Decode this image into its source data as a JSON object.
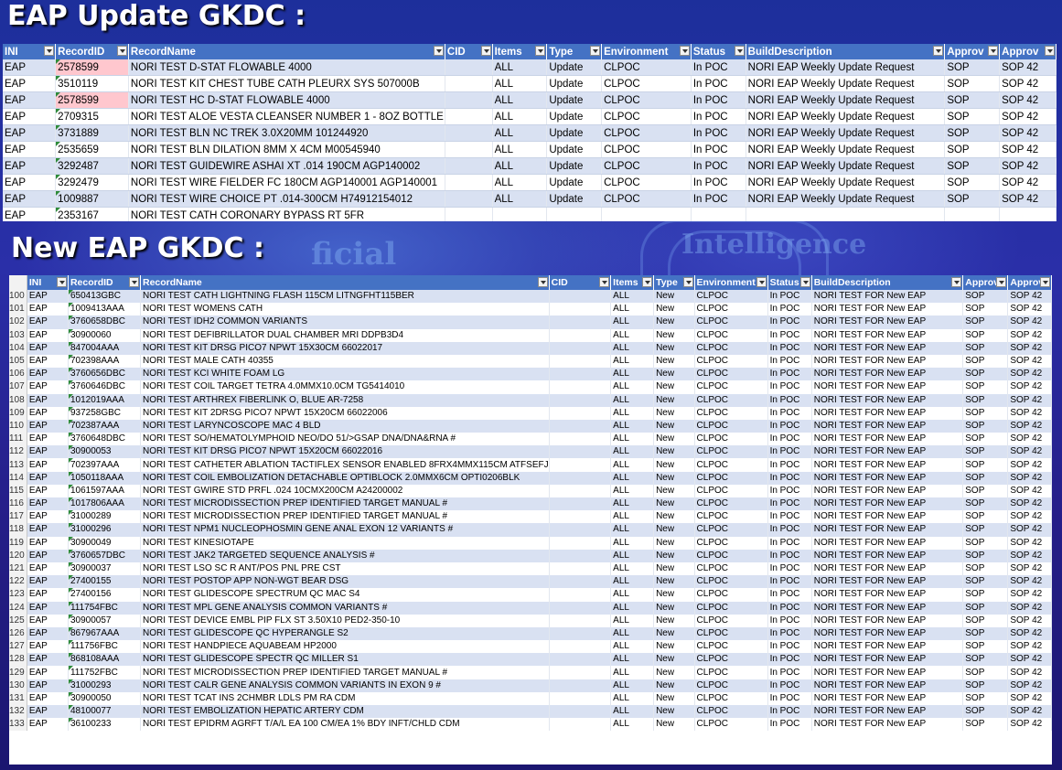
{
  "heading1": "EAP Update GKDC :",
  "heading2": "New EAP GKDC :",
  "background": {
    "word1": "ficial",
    "word2": "Intelligence"
  },
  "colors": {
    "header": "#4472c4",
    "band": "#d9e1f2",
    "highlight": "#ffc7ce",
    "background": "#23279e"
  },
  "update_table": {
    "headers": [
      "INI",
      "RecordID",
      "RecordName",
      "CID",
      "Items",
      "Type",
      "Environment",
      "Status",
      "BuildDescription",
      "Approv",
      "Approv"
    ],
    "rows": [
      [
        "EAP",
        "2578599",
        "NORI TEST D-STAT FLOWABLE 4000",
        "",
        "ALL",
        "Update",
        "CLPOC",
        "In POC",
        "NORI EAP Weekly Update Request",
        "SOP",
        "SOP 42"
      ],
      [
        "EAP",
        "3510119",
        "NORI TEST KIT CHEST TUBE CATH PLEURX SYS 507000B",
        "",
        "ALL",
        "Update",
        "CLPOC",
        "In POC",
        "NORI EAP Weekly Update Request",
        "SOP",
        "SOP 42"
      ],
      [
        "EAP",
        "2578599",
        "NORI TEST HC D-STAT FLOWABLE 4000",
        "",
        "ALL",
        "Update",
        "CLPOC",
        "In POC",
        "NORI EAP Weekly Update Request",
        "SOP",
        "SOP 42"
      ],
      [
        "EAP",
        "2709315",
        "NORI TEST ALOE VESTA CLEANSER NUMBER 1 -  8OZ BOTTLE",
        "",
        "ALL",
        "Update",
        "CLPOC",
        "In POC",
        "NORI EAP Weekly Update Request",
        "SOP",
        "SOP 42"
      ],
      [
        "EAP",
        "3731889",
        "NORI TEST BLN NC TREK 3.0X20MM 101244920",
        "",
        "ALL",
        "Update",
        "CLPOC",
        "In POC",
        "NORI EAP Weekly Update Request",
        "SOP",
        "SOP 42"
      ],
      [
        "EAP",
        "2535659",
        "NORI TEST BLN DILATION 8MM X 4CM M00545940",
        "",
        "ALL",
        "Update",
        "CLPOC",
        "In POC",
        "NORI EAP Weekly Update Request",
        "SOP",
        "SOP 42"
      ],
      [
        "EAP",
        "3292487",
        "NORI TEST GUIDEWIRE ASHAI XT .014 190CM AGP140002",
        "",
        "ALL",
        "Update",
        "CLPOC",
        "In POC",
        "NORI EAP Weekly Update Request",
        "SOP",
        "SOP 42"
      ],
      [
        "EAP",
        "3292479",
        "NORI TEST WIRE FIELDER FC 180CM AGP140001 AGP140001",
        "",
        "ALL",
        "Update",
        "CLPOC",
        "In POC",
        "NORI EAP Weekly Update Request",
        "SOP",
        "SOP 42"
      ],
      [
        "EAP",
        "1009887",
        "NORI TEST WIRE CHOICE PT .014-300CM H74912154012",
        "",
        "ALL",
        "Update",
        "CLPOC",
        "In POC",
        "NORI EAP Weekly Update Request",
        "SOP",
        "SOP 42"
      ],
      [
        "EAP",
        "2353167",
        "NORI TEST CATH CORONARY BYPASS RT 5FR",
        "",
        "",
        "",
        "",
        "",
        "",
        "",
        ""
      ]
    ],
    "highlighted_rows": [
      0,
      2
    ]
  },
  "new_table": {
    "headers": [
      "INI",
      "RecordID",
      "RecordName",
      "CID",
      "Items",
      "Type",
      "Environment",
      "Status",
      "BuildDescription",
      "Approv",
      "Approv"
    ],
    "rows": [
      [
        "100",
        "EAP",
        "650413GBC",
        "NORI TEST  CATH LIGHTNING FLASH 115CM LITNGFHT115BER"
      ],
      [
        "101",
        "EAP",
        "1009413AAA",
        "NORI TEST  WOMENS CATH"
      ],
      [
        "102",
        "EAP",
        "3760658DBC",
        "NORI TEST  IDH2 COMMON VARIANTS"
      ],
      [
        "103",
        "EAP",
        "30900060",
        "NORI TEST  DEFIBRILLATOR DUAL CHAMBER MRI DDPB3D4"
      ],
      [
        "104",
        "EAP",
        "847004AAA",
        "NORI TEST  KIT DRSG PICO7 NPWT 15X30CM 66022017"
      ],
      [
        "105",
        "EAP",
        "702398AAA",
        "NORI TEST  MALE CATH 40355"
      ],
      [
        "106",
        "EAP",
        "3760656DBC",
        "NORI TEST  KCI WHITE FOAM LG"
      ],
      [
        "107",
        "EAP",
        "3760646DBC",
        "NORI TEST  COIL TARGET TETRA 4.0MMX10.0CM TG5414010"
      ],
      [
        "108",
        "EAP",
        "1012019AAA",
        "NORI TEST  ARTHREX FIBERLINK O, BLUE AR-7258"
      ],
      [
        "109",
        "EAP",
        "937258GBC",
        "NORI TEST  KIT 2DRSG PICO7 NPWT 15X20CM 66022006"
      ],
      [
        "110",
        "EAP",
        "702387AAA",
        "NORI TEST  LARYNCOSCOPE MAC 4 BLD"
      ],
      [
        "111",
        "EAP",
        "3760648DBC",
        "NORI TEST  SO/HEMATOLYMPHOID NEO/DO 51/>GSAP DNA/DNA&RNA #"
      ],
      [
        "112",
        "EAP",
        "30900053",
        "NORI TEST  KIT DRSG PICO7 NPWT 15X20CM 66022016"
      ],
      [
        "113",
        "EAP",
        "702397AAA",
        "NORI TEST  CATHETER ABLATION TACTIFLEX SENSOR ENABLED 8FRX4MMX115CM ATFSEFJ"
      ],
      [
        "114",
        "EAP",
        "1050118AAA",
        "NORI TEST  COIL EMBOLIZATION DETACHABLE OPTIBLOCK 2.0MMX6CM OPTI0206BLK"
      ],
      [
        "115",
        "EAP",
        "1061597AAA",
        "NORI TEST  GWIRE STD PRFL .024 10CMX200CM A24200002"
      ],
      [
        "116",
        "EAP",
        "1017806AAA",
        "NORI TEST  MICRODISSECTION PREP IDENTIFIED TARGET MANUAL #"
      ],
      [
        "117",
        "EAP",
        "31000289",
        "NORI TEST  MICRODISSECTION PREP IDENTIFIED TARGET MANUAL #"
      ],
      [
        "118",
        "EAP",
        "31000296",
        "NORI TEST  NPM1 NUCLEOPHOSMIN GENE ANAL EXON 12 VARIANTS #"
      ],
      [
        "119",
        "EAP",
        "30900049",
        "NORI TEST  KINESIOTAPE"
      ],
      [
        "120",
        "EAP",
        "3760657DBC",
        "NORI TEST  JAK2 TARGETED SEQUENCE ANALYSIS #"
      ],
      [
        "121",
        "EAP",
        "30900037",
        "NORI TEST  LSO SC R ANT/POS PNL PRE CST"
      ],
      [
        "122",
        "EAP",
        "27400155",
        "NORI TEST  POSTOP APP NON-WGT BEAR DSG"
      ],
      [
        "123",
        "EAP",
        "27400156",
        "NORI TEST  GLIDESCOPE SPECTRUM QC MAC S4"
      ],
      [
        "124",
        "EAP",
        "111754FBC",
        "NORI TEST  MPL GENE ANALYSIS COMMON VARIANTS #"
      ],
      [
        "125",
        "EAP",
        "30900057",
        "NORI TEST  DEVICE EMBL PIP FLX ST 3.50X10  PED2-350-10"
      ],
      [
        "126",
        "EAP",
        "867967AAA",
        "NORI TEST  GLIDESCOPE QC HYPERANGLE S2"
      ],
      [
        "127",
        "EAP",
        "111756FBC",
        "NORI TEST  HANDPIECE AQUABEAM HP2000"
      ],
      [
        "128",
        "EAP",
        "868108AAA",
        "NORI TEST  GLIDESCOPE SPECTR QC MILLER S1"
      ],
      [
        "129",
        "EAP",
        "111752FBC",
        "NORI TEST  MICRODISSECTION PREP IDENTIFIED TARGET MANUAL #"
      ],
      [
        "130",
        "EAP",
        "31000293",
        "NORI TEST  CALR GENE ANALYSIS COMMON VARIANTS IN EXON 9 #"
      ],
      [
        "131",
        "EAP",
        "30900050",
        "NORI TEST  TCAT INS 2CHMBR LDLS PM RA CDM"
      ],
      [
        "132",
        "EAP",
        "48100077",
        "NORI TEST  EMBOLIZATION HEPATIC ARTERY CDM"
      ],
      [
        "133",
        "EAP",
        "36100233",
        "NORI TEST  EPIDRM AGRFT T/A/L EA 100 CM/EA 1% BDY INFT/CHLD  CDM"
      ]
    ],
    "common_values": {
      "cid": "",
      "items": "ALL",
      "type": "New",
      "environment": "CLPOC",
      "status": "In POC",
      "build_description": "NORI TEST FOR New EAP",
      "approv": "SOP",
      "approv2": "SOP 42"
    }
  }
}
